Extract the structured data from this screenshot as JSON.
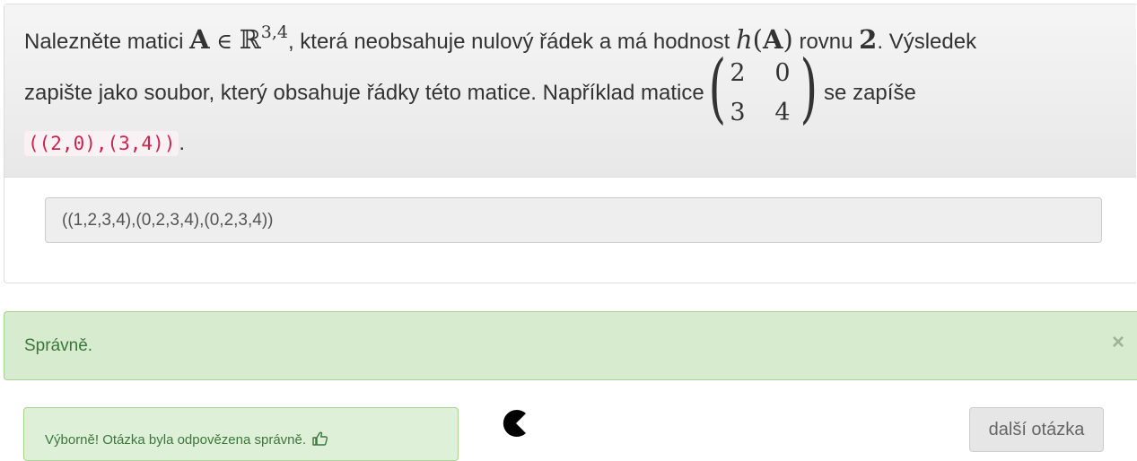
{
  "question": {
    "line1_prefix": "Nalezněte matici ",
    "matrix_symbol": "A",
    "element_of": " ∈ ",
    "reals": "ℝ",
    "reals_sup": "3,4",
    "line1_middle": ", která neobsahuje nulový řádek a má hodnost ",
    "rank_fn": "h",
    "rank_open": "(",
    "rank_arg": "A",
    "rank_close": ")",
    "line1_after_rank": " rovnu ",
    "rank_value": "2",
    "line1_suffix": ". Výsledek",
    "line2_prefix": "zapište jako soubor, který obsahuje řádky této matice. Například matice ",
    "example_matrix": [
      "2",
      "0",
      "3",
      "4"
    ],
    "line2_suffix": " se zapíše",
    "example_code": "((2,0),(3,4))",
    "line3_suffix": "."
  },
  "answer": {
    "value": "((1,2,3,4),(0,2,3,4),(0,2,3,4))"
  },
  "result_alert": {
    "text": "Správně.",
    "close_symbol": "×"
  },
  "feedback": {
    "text": "Výborně! Otázka byla odpovězena správně."
  },
  "next_button": {
    "label": "další otázka"
  },
  "icons": {
    "thumb": "thumbs-up-icon",
    "pacman": "pacman-icon"
  },
  "colors": {
    "success_text": "#3c763d",
    "success_bg": "#dff0d8",
    "code_text": "#c7254e"
  }
}
